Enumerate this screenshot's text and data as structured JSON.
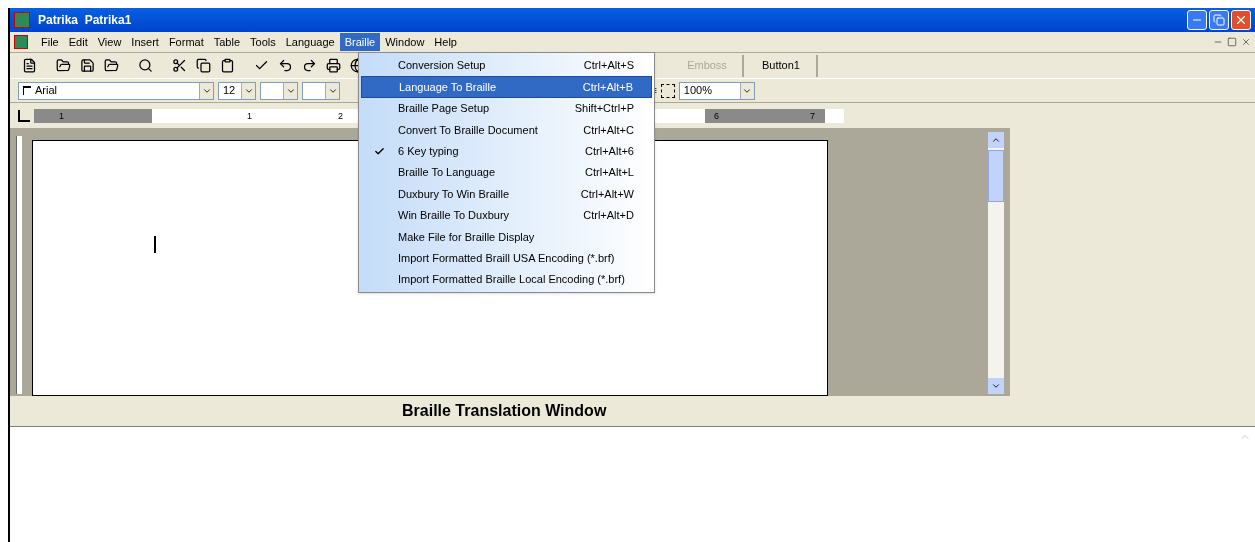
{
  "window": {
    "title": "Patrika  Patrika1"
  },
  "menu_bar": [
    {
      "label": "File",
      "selected": false
    },
    {
      "label": "Edit",
      "selected": false
    },
    {
      "label": "View",
      "selected": false
    },
    {
      "label": "Insert",
      "selected": false
    },
    {
      "label": "Format",
      "selected": false
    },
    {
      "label": "Table",
      "selected": false
    },
    {
      "label": "Tools",
      "selected": false
    },
    {
      "label": "Language",
      "selected": false
    },
    {
      "label": "Braille",
      "selected": true
    },
    {
      "label": "Window",
      "selected": false
    },
    {
      "label": "Help",
      "selected": false
    }
  ],
  "braille_menu": [
    {
      "label": "Conversion Setup",
      "shortcut": "Ctrl+Alt+S",
      "checked": false,
      "selected": false
    },
    {
      "label": "Language To Braille",
      "shortcut": "Ctrl+Alt+B",
      "checked": false,
      "selected": true
    },
    {
      "label": "Braille Page Setup",
      "shortcut": "Shift+Ctrl+P",
      "checked": false,
      "selected": false
    },
    {
      "label": "Convert To Braille Document",
      "shortcut": "Ctrl+Alt+C",
      "checked": false,
      "selected": false
    },
    {
      "label": "6 Key typing",
      "shortcut": "Ctrl+Alt+6",
      "checked": true,
      "selected": false
    },
    {
      "label": "Braille To Language",
      "shortcut": "Ctrl+Alt+L",
      "checked": false,
      "selected": false
    },
    {
      "label": "Duxbury To Win Braille",
      "shortcut": "Ctrl+Alt+W",
      "checked": false,
      "selected": false
    },
    {
      "label": "Win Braille To Duxbury",
      "shortcut": "Ctrl+Alt+D",
      "checked": false,
      "selected": false
    },
    {
      "label": "Make File for Braille Display",
      "checked": false,
      "selected": false
    },
    {
      "label": "Import Formatted Braill USA Encoding (*.brf)",
      "checked": false,
      "selected": false
    },
    {
      "label": "Import Formatted Braille Local Encoding (*.brf)",
      "checked": false,
      "selected": false
    }
  ],
  "toolbar": {
    "buttons": [
      {
        "label": "Emboss",
        "disabled": true
      },
      {
        "label": "Button1",
        "disabled": false
      }
    ]
  },
  "format_bar": {
    "font": "Arial",
    "size": "12",
    "zoom": "100%"
  },
  "ruler": {
    "labels": [
      "1",
      "1",
      "2",
      "6",
      "7"
    ]
  },
  "translation_panel": {
    "title": "Braille Translation Window"
  }
}
